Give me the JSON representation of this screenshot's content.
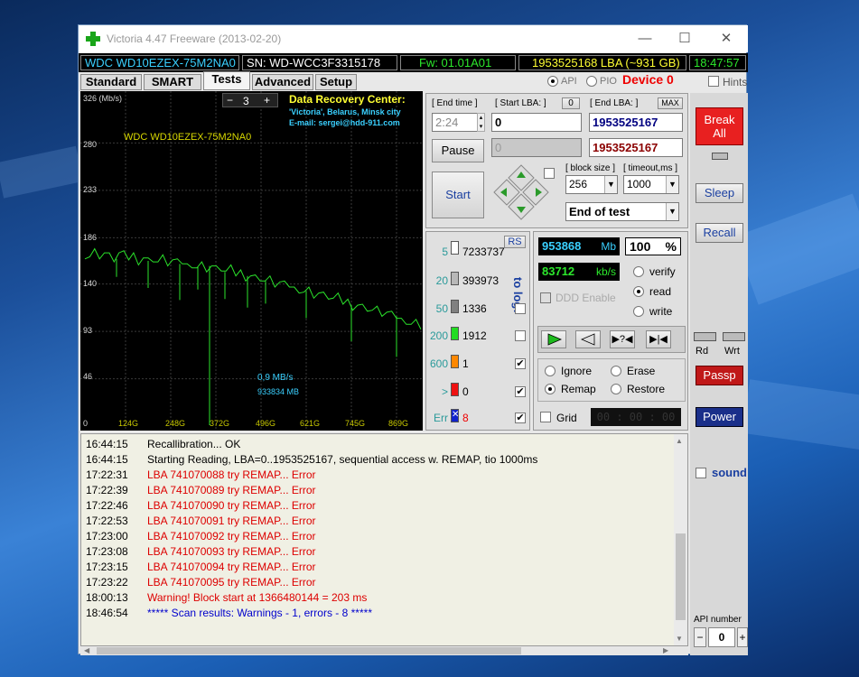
{
  "window": {
    "title": "Victoria 4.47  Freeware (2013-02-20)",
    "minimize": "—",
    "maximize": "☐",
    "close": "✕"
  },
  "infobar": {
    "model": "WDC WD10EZEX-75M2NA0",
    "serial": "SN: WD-WCC3F3315178",
    "firmware": "Fw: 01.01A01",
    "capacity": "1953525168 LBA (~931 GB)",
    "clock": "18:47:57"
  },
  "tabs": [
    "Standard",
    "SMART",
    "Tests",
    "Advanced",
    "Setup"
  ],
  "active_tab": "Tests",
  "mode": {
    "api": "API",
    "pio": "PIO",
    "device": "Device 0"
  },
  "hints": "Hints",
  "graph": {
    "y_unit": "326 (Mb/s)",
    "y_ticks": [
      "280",
      "233",
      "186",
      "140",
      "93",
      "46",
      "0"
    ],
    "x_ticks": [
      "124G",
      "248G",
      "372G",
      "496G",
      "621G",
      "745G",
      "869G"
    ],
    "zoom_minus": "−",
    "zoom_value": "3",
    "zoom_plus": "+",
    "drive_label": "WDC WD10EZEX-75M2NA0",
    "speed": "0,9 MB/s",
    "position": "933834 MB",
    "promo": {
      "title": "Data Recovery Center:",
      "line1": "'Victoria', Belarus, Minsk city",
      "line2": "E-mail: sergei@hdd-911.com"
    },
    "series": [
      170,
      168,
      172,
      169,
      171,
      167,
      165,
      170,
      168,
      166,
      169,
      164,
      167,
      163,
      166,
      162,
      165,
      161,
      163,
      160,
      162,
      158,
      161,
      157,
      159,
      156,
      158,
      154,
      156,
      152,
      154,
      150,
      152,
      148,
      149,
      146,
      147,
      143,
      144,
      140,
      141,
      138,
      139,
      135,
      136,
      133,
      134,
      130,
      131,
      128,
      128,
      125,
      126,
      122,
      123,
      119,
      120,
      117,
      117,
      114,
      114,
      111,
      111,
      108,
      108,
      104,
      105,
      101,
      102,
      99
    ]
  },
  "control": {
    "end_time_label": "[ End time ]",
    "end_time_value": "2:24",
    "start_lba_label": "[ Start LBA: ]",
    "start_lba_btn": "0",
    "start_lba_value": "0",
    "start_lba_current": "0",
    "end_lba_label": "[ End LBA: ]",
    "end_lba_btn": "MAX",
    "end_lba_value": "1953525167",
    "end_lba_current": "1953525167",
    "pause_button": "Pause",
    "start_button": "Start",
    "block_size_label": "[ block size ]",
    "block_size_value": "256",
    "timeout_label": "[ timeout,ms ]",
    "timeout_value": "1000",
    "end_action": "End of test"
  },
  "blocks": {
    "rs": "RS",
    "to_log": "to log:",
    "rows": [
      {
        "threshold": "5",
        "count": "7233737",
        "color": "#ffffff",
        "log": false
      },
      {
        "threshold": "20",
        "count": "393973",
        "color": "#b8b8b8",
        "log": false
      },
      {
        "threshold": "50",
        "count": "1336",
        "color": "#808080",
        "log": false
      },
      {
        "threshold": "200",
        "count": "1912",
        "color": "#22dd22",
        "log": false
      },
      {
        "threshold": "600",
        "count": "1",
        "color": "#ff8800",
        "log": true
      },
      {
        "threshold": ">",
        "count": "0",
        "color": "#ee1111",
        "log": true
      },
      {
        "threshold": "Err",
        "count": "8",
        "color": "#1122cc",
        "log": true
      }
    ]
  },
  "stats": {
    "mb_value": "953868",
    "mb_unit": "Mb",
    "percent_value": "100",
    "percent_unit": "%",
    "kbs_value": "83712",
    "kbs_unit": "kb/s",
    "ddd_enable": "DDD Enable",
    "verify": "verify",
    "read": "read",
    "write": "write",
    "ignore": "Ignore",
    "erase": "Erase",
    "remap": "Remap",
    "restore": "Restore",
    "grid": "Grid",
    "timer": "00 : 00 : 00"
  },
  "right_panel": {
    "break_all": "Break All",
    "sleep": "Sleep",
    "recall": "Recall",
    "rd": "Rd",
    "wrt": "Wrt",
    "passp": "Passp",
    "power": "Power",
    "sound": "sound",
    "api_number_label": "API number",
    "api_number_value": "0",
    "api_minus": "−",
    "api_plus": "+"
  },
  "log": [
    {
      "time": "16:44:15",
      "msg": "Recallibration... OK",
      "color": "#000000"
    },
    {
      "time": "16:44:15",
      "msg": "Starting Reading, LBA=0..1953525167, sequential access w. REMAP, tio 1000ms",
      "color": "#000000"
    },
    {
      "time": "17:22:31",
      "msg": "LBA 741070088 try REMAP... Error",
      "color": "#dd0000"
    },
    {
      "time": "17:22:39",
      "msg": "LBA 741070089 try REMAP... Error",
      "color": "#dd0000"
    },
    {
      "time": "17:22:46",
      "msg": "LBA 741070090 try REMAP... Error",
      "color": "#dd0000"
    },
    {
      "time": "17:22:53",
      "msg": "LBA 741070091 try REMAP... Error",
      "color": "#dd0000"
    },
    {
      "time": "17:23:00",
      "msg": "LBA 741070092 try REMAP... Error",
      "color": "#dd0000"
    },
    {
      "time": "17:23:08",
      "msg": "LBA 741070093 try REMAP... Error",
      "color": "#dd0000"
    },
    {
      "time": "17:23:15",
      "msg": "LBA 741070094 try REMAP... Error",
      "color": "#dd0000"
    },
    {
      "time": "17:23:22",
      "msg": "LBA 741070095 try REMAP... Error",
      "color": "#dd0000"
    },
    {
      "time": "18:00:13",
      "msg": "Warning! Block start at 1366480144 = 203 ms",
      "color": "#dd0000"
    },
    {
      "time": "18:46:54",
      "msg": "***** Scan results: Warnings - 1, errors - 8 *****",
      "color": "#0000cc"
    }
  ]
}
